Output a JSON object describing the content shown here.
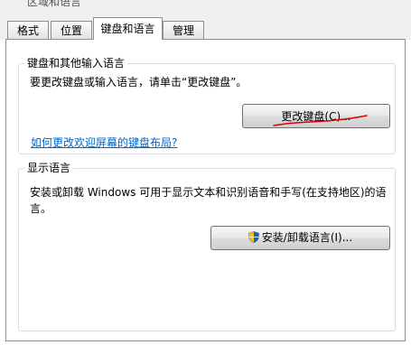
{
  "window": {
    "title": "区域和语言"
  },
  "tabs": [
    {
      "label": "格式"
    },
    {
      "label": "位置"
    },
    {
      "label": "键盘和语言",
      "active": true
    },
    {
      "label": "管理"
    }
  ],
  "keyboard_group": {
    "title": "键盘和其他输入语言",
    "description": "要更改键盘或输入语言，请单击“更改键盘”。",
    "change_button": "更改键盘(C)...",
    "help_link": "如何更改欢迎屏幕的键盘布局?"
  },
  "display_group": {
    "title": "显示语言",
    "description_line1": "安装或卸载 Windows 可用于显示文本和识别语音和手写(在支持地区)的语",
    "description_line2": "言。",
    "install_button": "安装/卸载语言(I)...",
    "install_button_icon": "uac-shield-icon"
  },
  "annotation": {
    "color": "#e00000"
  }
}
